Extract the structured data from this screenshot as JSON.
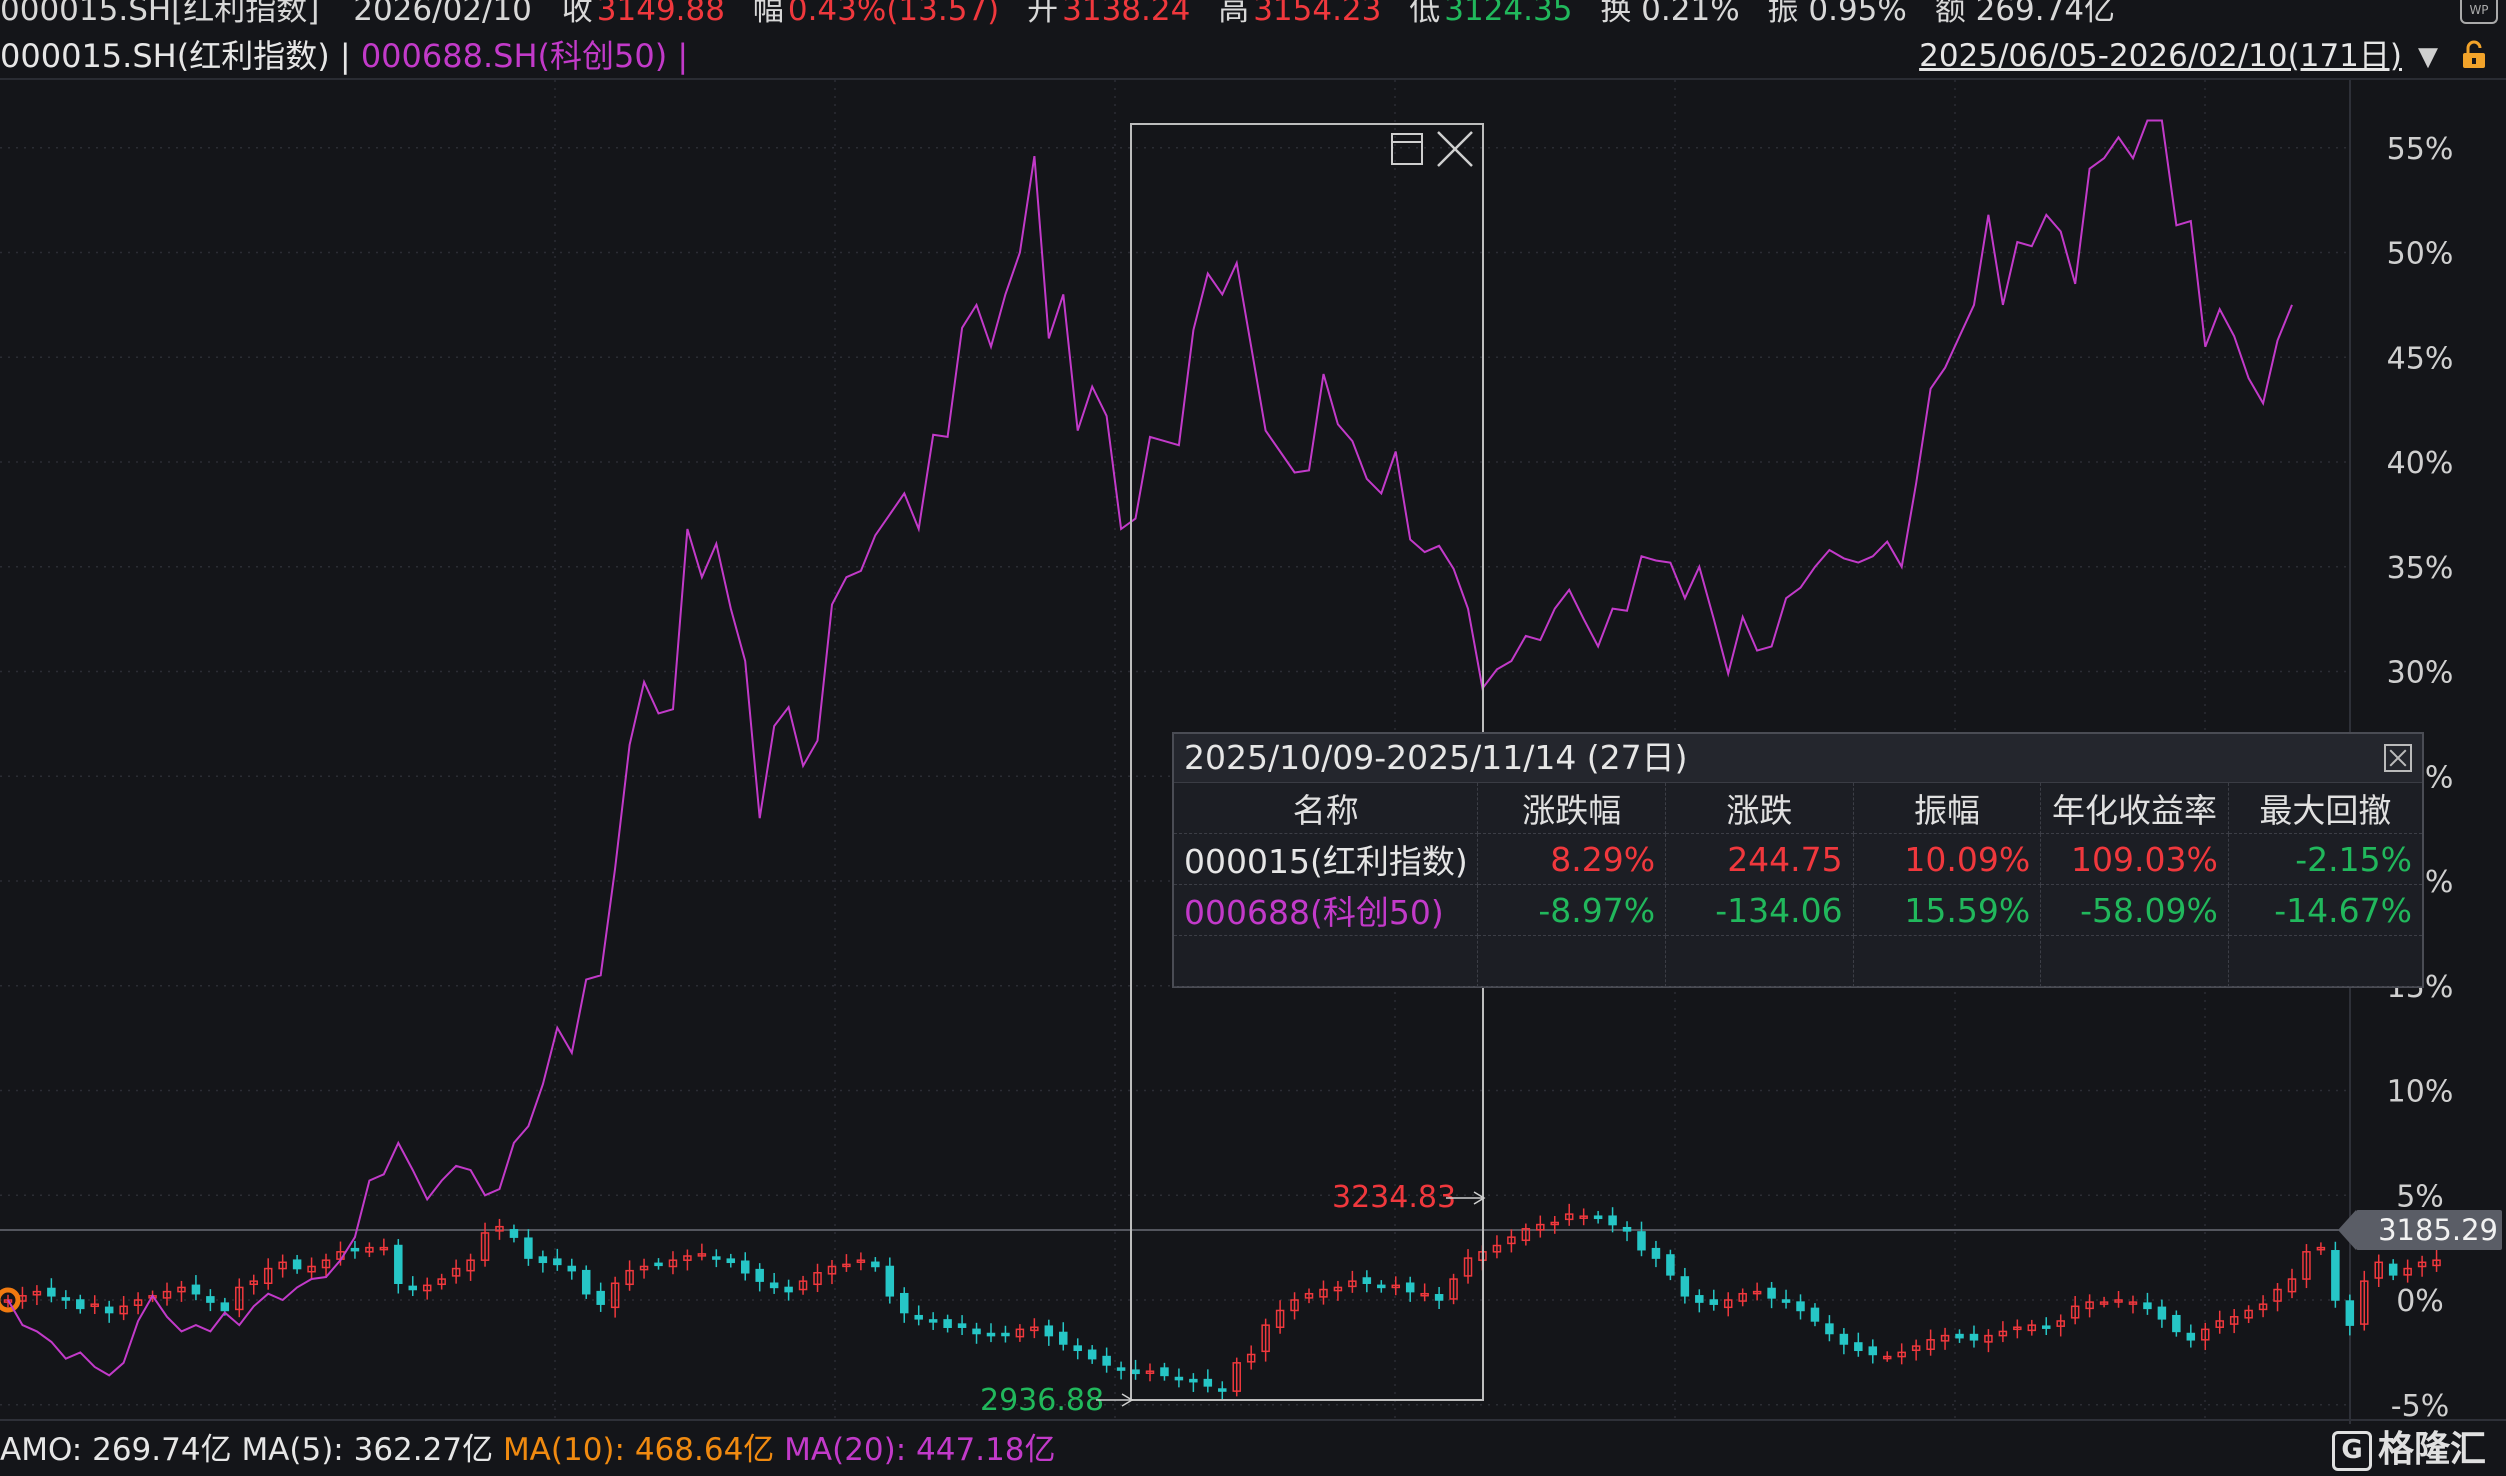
{
  "header": {
    "code": "000015.SH[红利指数]",
    "date": "2026/02/10",
    "close_label": "收",
    "close": "3149.88",
    "change_label": "幅",
    "change": "0.43%(13.57)",
    "open_label": "开",
    "open": "3138.24",
    "high_label": "高",
    "high": "3154.23",
    "low_label": "低",
    "low": "3124.35",
    "turnover": "换 0.21%",
    "amplitude": "振 0.95%",
    "amount": "额 269.74亿"
  },
  "legend": {
    "series1": "000015.SH(红利指数) |",
    "series2": "000688.SH(科创50) |"
  },
  "range": "2025/06/05-2026/02/10(171日)",
  "chart_data": {
    "type": "line",
    "y_ticks": [
      "55%",
      "50%",
      "45%",
      "40%",
      "35%",
      "30%",
      "25%",
      "20%",
      "15%",
      "10%",
      "5%",
      "0%",
      "-5%"
    ],
    "ylim": [
      -5.5,
      57
    ],
    "x": "171 trading days 2025/06/05 - 2026/02/10",
    "series": [
      {
        "name": "000688.SH(科创50)",
        "color": "#c23ac9",
        "values": [
          0.0,
          -1.2,
          -1.5,
          -2.0,
          -2.8,
          -2.5,
          -3.2,
          -3.6,
          -3.0,
          -1.0,
          0.2,
          -0.8,
          -1.5,
          -1.2,
          -1.5,
          -0.6,
          -1.2,
          -0.3,
          0.3,
          0.0,
          0.6,
          1.0,
          1.1,
          1.9,
          3.0,
          5.7,
          6.0,
          7.5,
          6.2,
          4.8,
          5.7,
          6.4,
          6.2,
          5.0,
          5.3,
          7.5,
          8.3,
          10.3,
          13.0,
          11.8,
          15.3,
          15.5,
          20.6,
          26.5,
          29.5,
          28.0,
          28.2,
          36.8,
          34.5,
          36.1,
          33.0,
          30.5,
          23.0,
          27.4,
          28.3,
          25.5,
          26.7,
          33.2,
          34.5,
          34.8,
          36.5,
          37.5,
          38.5,
          36.8,
          41.3,
          41.2,
          46.4,
          47.5,
          45.5,
          48.0,
          50.0,
          54.6,
          45.9,
          48.0,
          41.5,
          43.6,
          42.2,
          36.8,
          37.3,
          41.2,
          41.0,
          40.8,
          46.3,
          49.0,
          48.0,
          49.5,
          45.5,
          41.5,
          40.5,
          39.5,
          39.6,
          44.2,
          41.8,
          41.0,
          39.2,
          38.5,
          40.5,
          36.3,
          35.7,
          36.0,
          34.9,
          33.0,
          29.2,
          30.1,
          30.5,
          31.7,
          31.5,
          33.0,
          33.9,
          32.5,
          31.2,
          33.0,
          32.9,
          35.5,
          35.3,
          35.2,
          33.5,
          35.0,
          32.5,
          29.9,
          32.6,
          31.0,
          31.2,
          33.5,
          34.0,
          35.0,
          35.8,
          35.4,
          35.2,
          35.5,
          36.2,
          35.0,
          39.0,
          43.5,
          44.5,
          46.0,
          47.5,
          51.8,
          47.5,
          50.5,
          50.3,
          51.8,
          51.0,
          48.5,
          54.0,
          54.5,
          55.5,
          54.5,
          56.3,
          56.3,
          51.3,
          51.5,
          45.5,
          47.3,
          46.0,
          44.0,
          42.8,
          45.8,
          47.5
        ],
        "line_width": 2
      },
      {
        "name": "000015.SH(红利指数)",
        "kind": "candlestick",
        "values": [
          0.0,
          0.2,
          0.4,
          0.2,
          0.0,
          -0.4,
          -0.2,
          -0.6,
          -0.3,
          0.0,
          0.2,
          0.4,
          0.6,
          0.3,
          -0.1,
          -0.5,
          0.6,
          0.9,
          1.5,
          1.8,
          1.5,
          1.6,
          1.9,
          2.3,
          2.4,
          2.5,
          2.5,
          0.8,
          0.5,
          0.7,
          1.0,
          1.5,
          1.9,
          3.2,
          3.5,
          3.0,
          2.0,
          1.8,
          1.7,
          1.4,
          0.3,
          -0.2,
          0.8,
          1.4,
          1.6,
          1.7,
          1.9,
          2.1,
          2.2,
          2.0,
          1.8,
          1.3,
          0.9,
          0.6,
          0.4,
          0.9,
          1.3,
          1.6,
          1.7,
          1.9,
          1.6,
          0.2,
          -0.6,
          -0.9,
          -1.0,
          -1.3,
          -1.3,
          -1.6,
          -1.7,
          -1.6,
          -1.4,
          -1.3,
          -1.7,
          -2.1,
          -2.4,
          -2.8,
          -3.1,
          -3.3,
          -3.5,
          -3.4,
          -3.6,
          -3.8,
          -3.9,
          -4.1,
          -4.3,
          -3.0,
          -2.6,
          -1.2,
          -0.5,
          0.0,
          0.3,
          0.5,
          0.6,
          0.9,
          0.8,
          0.6,
          0.7,
          0.4,
          0.3,
          0.0,
          1.0,
          2.0,
          2.3,
          2.6,
          3.0,
          3.4,
          3.6,
          3.7,
          4.1,
          4.0,
          3.9,
          3.6,
          3.3,
          2.4,
          2.0,
          1.2,
          0.2,
          -0.1,
          -0.2,
          0.0,
          0.3,
          0.4,
          0.1,
          -0.1,
          -0.5,
          -1.0,
          -1.6,
          -2.1,
          -2.4,
          -2.6,
          -2.7,
          -2.5,
          -2.2,
          -1.9,
          -1.7,
          -1.8,
          -1.9,
          -1.7,
          -1.5,
          -1.3,
          -1.2,
          -1.3,
          -1.0,
          -0.3,
          -0.1,
          -0.1,
          0.0,
          -0.1,
          -0.4,
          -0.9,
          -1.5,
          -1.9,
          -1.4,
          -1.0,
          -0.8,
          -0.5,
          -0.2,
          0.5,
          1.0,
          2.3,
          2.5,
          0.0,
          -1.2,
          0.9,
          1.8,
          1.2,
          1.5,
          1.8,
          1.9
        ]
      }
    ],
    "annotations": {
      "high_label": "3234.83",
      "low_label": "2936.88",
      "current_price": "3185.29"
    },
    "selection": {
      "start": "2025/10/09",
      "end": "2025/11/14"
    }
  },
  "popup": {
    "title": "2025/10/09-2025/11/14 (27日)",
    "columns": [
      "名称",
      "涨跌幅",
      "涨跌",
      "振幅",
      "年化收益率",
      "最大回撤"
    ],
    "rows": [
      {
        "name": "000015(红利指数)",
        "c1": "8.29%",
        "c2": "244.75",
        "c3": "10.09%",
        "c4": "109.03%",
        "c5": "-2.15%",
        "name_color": "white"
      },
      {
        "name": "000688(科创50)",
        "c1": "-8.97%",
        "c2": "-134.06",
        "c3": "15.59%",
        "c4": "-58.09%",
        "c5": "-14.67%",
        "name_color": "purple"
      }
    ]
  },
  "footer": {
    "amo": "AMO: 269.74亿",
    "ma5": "MA(5): 362.27亿",
    "ma10": "MA(10): 468.64亿",
    "ma20": "MA(20): 447.18亿"
  },
  "brand": {
    "logo": "G",
    "name": "格隆汇"
  },
  "colors": {
    "up": "#f0383d",
    "down": "#26c6c6",
    "series2": "#c23ac9",
    "bg": "#141519"
  }
}
